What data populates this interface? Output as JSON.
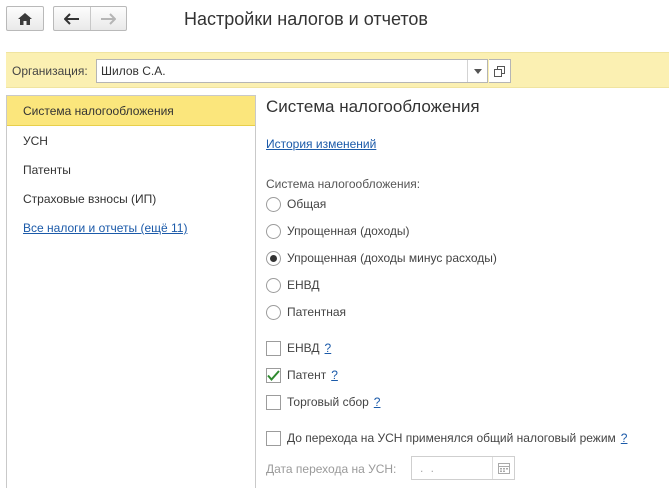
{
  "header": {
    "title": "Настройки налогов и отчетов",
    "home_icon": "home-icon",
    "back_icon": "arrow-left-icon",
    "forward_icon": "arrow-right-icon"
  },
  "organization": {
    "label": "Организация:",
    "value": "Шилов С.А."
  },
  "sidebar": {
    "items": [
      {
        "label": "Система налогообложения",
        "active": true
      },
      {
        "label": "УСН"
      },
      {
        "label": "Патенты"
      },
      {
        "label": "Страховые взносы (ИП)"
      },
      {
        "label": "Все налоги и отчеты (ещё 11)",
        "link": true
      }
    ]
  },
  "main": {
    "title": "Система налогообложения",
    "history_link": "История изменений",
    "tax_system_label": "Система налогообложения:",
    "radios": [
      {
        "label": "Общая",
        "selected": false
      },
      {
        "label": "Упрощенная (доходы)",
        "selected": false
      },
      {
        "label": "Упрощенная (доходы минус расходы)",
        "selected": true
      },
      {
        "label": "ЕНВД",
        "selected": false
      },
      {
        "label": "Патентная",
        "selected": false
      }
    ],
    "checkboxes": [
      {
        "label": "ЕНВД",
        "checked": false,
        "help": "?"
      },
      {
        "label": "Патент",
        "checked": true,
        "help": "?"
      },
      {
        "label": "Торговый сбор",
        "checked": false,
        "help": "?"
      },
      {
        "label": "До перехода на УСН применялся общий налоговый режим",
        "checked": false,
        "help": "?"
      }
    ],
    "transition_date_label": "Дата перехода на УСН:",
    "transition_date_value": " .  .  "
  },
  "colors": {
    "accent_yellow": "#fbe67c",
    "org_bar": "#fbf0b2",
    "link": "#1b5aa9"
  }
}
